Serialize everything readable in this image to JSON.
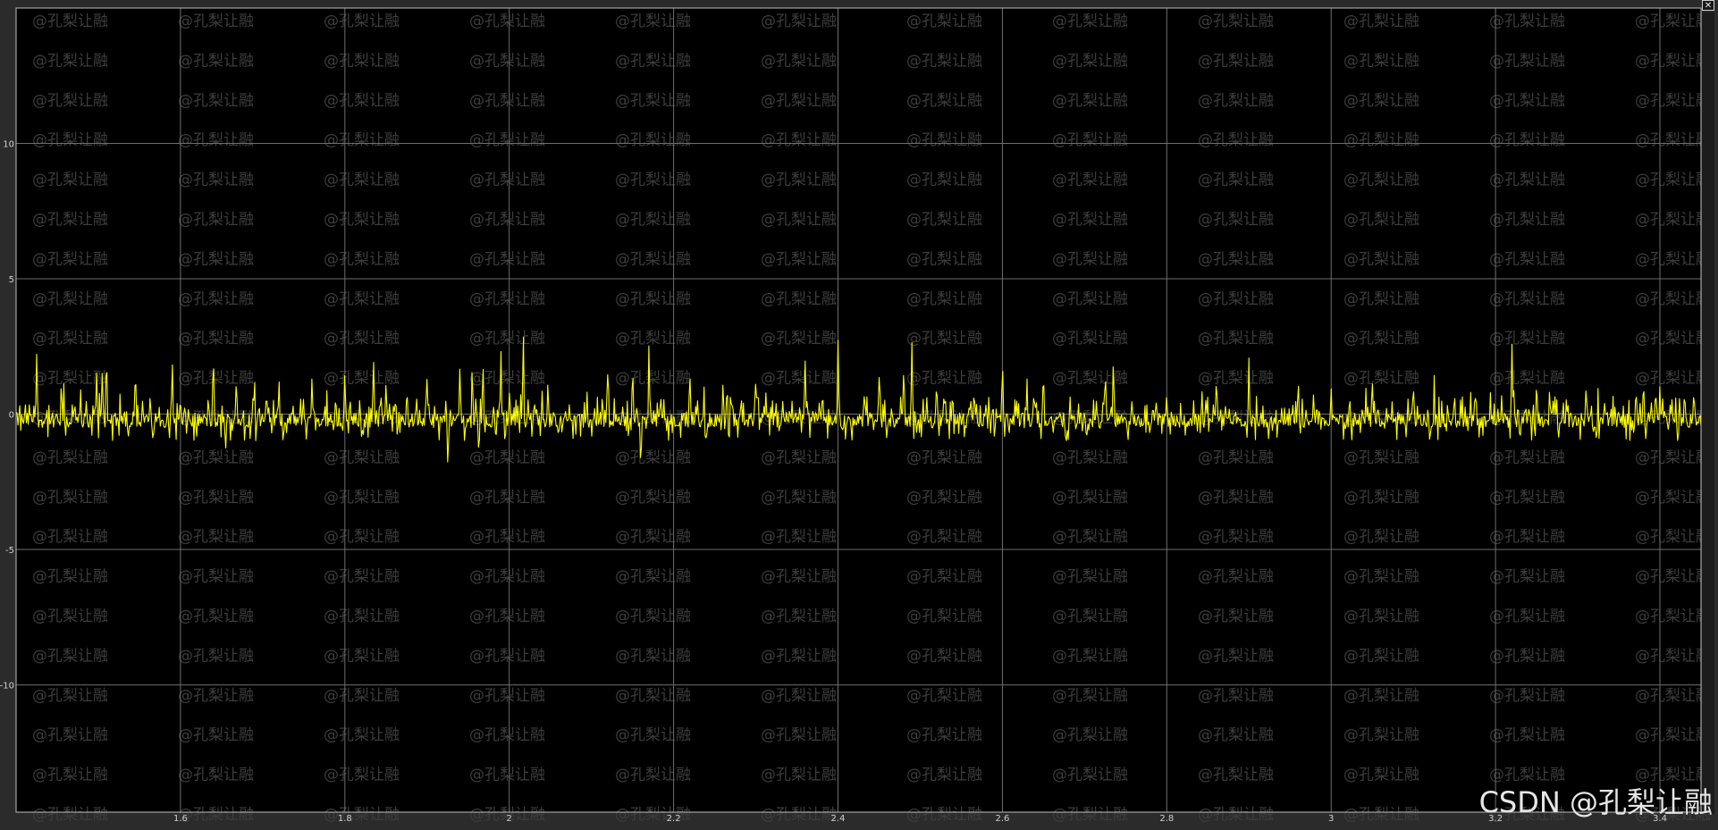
{
  "window": {
    "close_glyph": "✕"
  },
  "watermark": {
    "text": "@孔梨让融"
  },
  "credit": {
    "text": "CSDN @孔梨让融"
  },
  "colors": {
    "background": "#000000",
    "frame": "#2b2b2b",
    "grid": "#6e6e6e",
    "axis": "#bdbdbd",
    "signal": "#ffff00"
  },
  "chart_data": {
    "type": "line",
    "title": "",
    "xlabel": "",
    "ylabel": "",
    "xlim": [
      1.4,
      3.45
    ],
    "ylim": [
      -14.7,
      15
    ],
    "grid": true,
    "legend": "none",
    "xticks": [
      1.6,
      1.8,
      2.0,
      2.2,
      2.4,
      2.6,
      2.8,
      3.0,
      3.2,
      3.4
    ],
    "xtick_labels": [
      "1.6",
      "1.8",
      "2",
      "2.2",
      "2.4",
      "2.6",
      "2.8",
      "3",
      "3.2",
      "3.4"
    ],
    "yticks": [
      10,
      5,
      0,
      -5,
      -10
    ],
    "ytick_labels": [
      "10",
      "5",
      "0",
      "-5",
      "-10"
    ],
    "series": [
      {
        "color": "#ffff00",
        "x_start": 1.4,
        "x_end": 3.45,
        "baseline": -0.25,
        "noise_amplitude": 0.45,
        "spikes": [
          [
            1.425,
            2.3
          ],
          [
            1.455,
            1.2
          ],
          [
            1.498,
            1.6
          ],
          [
            1.505,
            1.8
          ],
          [
            1.51,
            2.3
          ],
          [
            1.545,
            1.5
          ],
          [
            1.59,
            2.1
          ],
          [
            1.62,
            -0.9
          ],
          [
            1.64,
            2.0
          ],
          [
            1.655,
            -1.3
          ],
          [
            1.668,
            1.4
          ],
          [
            1.69,
            1.7
          ],
          [
            1.72,
            1.2
          ],
          [
            1.76,
            1.4
          ],
          [
            1.8,
            1.7
          ],
          [
            1.835,
            2.0
          ],
          [
            1.85,
            1.2
          ],
          [
            1.9,
            1.3
          ],
          [
            1.925,
            -1.8
          ],
          [
            1.94,
            1.9
          ],
          [
            1.955,
            2.0
          ],
          [
            1.963,
            -1.5
          ],
          [
            1.968,
            2.1
          ],
          [
            1.99,
            2.4
          ],
          [
            1.995,
            -1.2
          ],
          [
            2.017,
            3.4
          ],
          [
            2.04,
            0.9
          ],
          [
            2.06,
            -0.8
          ],
          [
            2.12,
            1.6
          ],
          [
            2.15,
            1.9
          ],
          [
            2.16,
            -2.1
          ],
          [
            2.17,
            2.7
          ],
          [
            2.22,
            1.3
          ],
          [
            2.26,
            1.2
          ],
          [
            2.3,
            1.4
          ],
          [
            2.36,
            2.1
          ],
          [
            2.4,
            2.8
          ],
          [
            2.405,
            -0.9
          ],
          [
            2.45,
            1.4
          ],
          [
            2.48,
            1.9
          ],
          [
            2.49,
            2.8
          ],
          [
            2.52,
            1.3
          ],
          [
            2.59,
            -0.9
          ],
          [
            2.6,
            2.3
          ],
          [
            2.63,
            1.3
          ],
          [
            2.65,
            1.8
          ],
          [
            2.725,
            1.4
          ],
          [
            2.735,
            2.2
          ],
          [
            2.8,
            0.9
          ],
          [
            2.86,
            1.1
          ],
          [
            2.9,
            2.2
          ],
          [
            2.96,
            1.2
          ],
          [
            3.0,
            1.1
          ],
          [
            3.05,
            1.4
          ],
          [
            3.1,
            1.2
          ],
          [
            3.15,
            0.9
          ],
          [
            3.22,
            2.7
          ],
          [
            3.25,
            1.3
          ],
          [
            3.31,
            0.9
          ],
          [
            3.38,
            1.3
          ],
          [
            3.4,
            1.1
          ],
          [
            3.43,
            0.7
          ]
        ]
      }
    ]
  }
}
